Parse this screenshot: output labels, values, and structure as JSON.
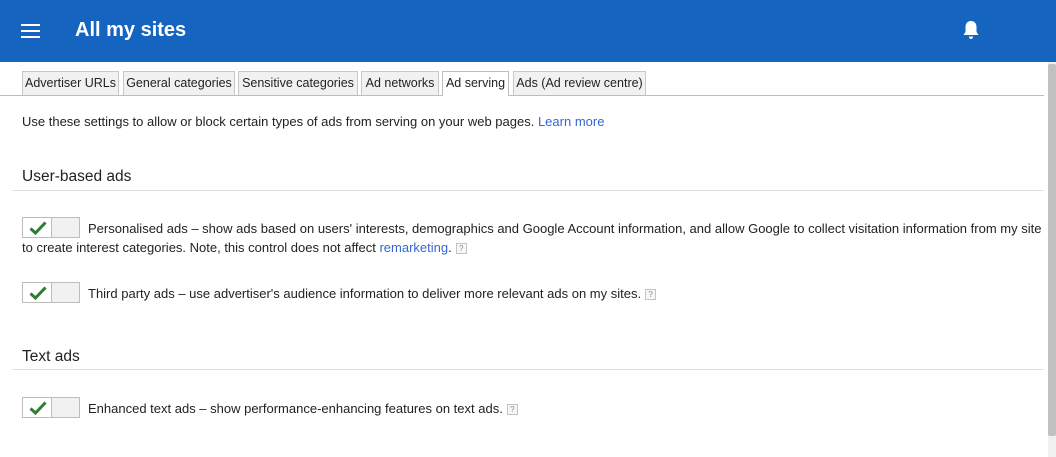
{
  "header": {
    "menu_icon": "hamburger-menu-icon",
    "title": "All my sites",
    "notification_icon": "bell-icon",
    "background": "#1565c0"
  },
  "tabs": [
    {
      "label": "Advertiser URLs",
      "active": false
    },
    {
      "label": "General categories",
      "active": false
    },
    {
      "label": "Sensitive categories",
      "active": false
    },
    {
      "label": "Ad networks",
      "active": false
    },
    {
      "label": "Ad serving",
      "active": true
    },
    {
      "label": "Ads (Ad review centre)",
      "active": false
    }
  ],
  "intro": {
    "text": "Use these settings to allow or block certain types of ads from serving on your web pages.",
    "link": "Learn more"
  },
  "sections": {
    "user_based": {
      "title": "User-based ads",
      "personalised": {
        "enabled": true,
        "text": "Personalised ads – show ads based on users' interests, demographics and Google Account information, and allow Google to collect visitation information from my site to create interest categories. Note, this control does not affect",
        "link": "remarketing",
        "suffix": "."
      },
      "third_party": {
        "enabled": true,
        "text": "Third party ads – use advertiser's audience information to deliver more relevant ads on my sites."
      }
    },
    "text_ads": {
      "title": "Text ads",
      "enhanced": {
        "enabled": true,
        "text": "Enhanced text ads – show performance-enhancing features on text ads."
      }
    }
  },
  "help_glyph": "?",
  "colors": {
    "check": "#2e7d32",
    "link": "#3367d6"
  }
}
